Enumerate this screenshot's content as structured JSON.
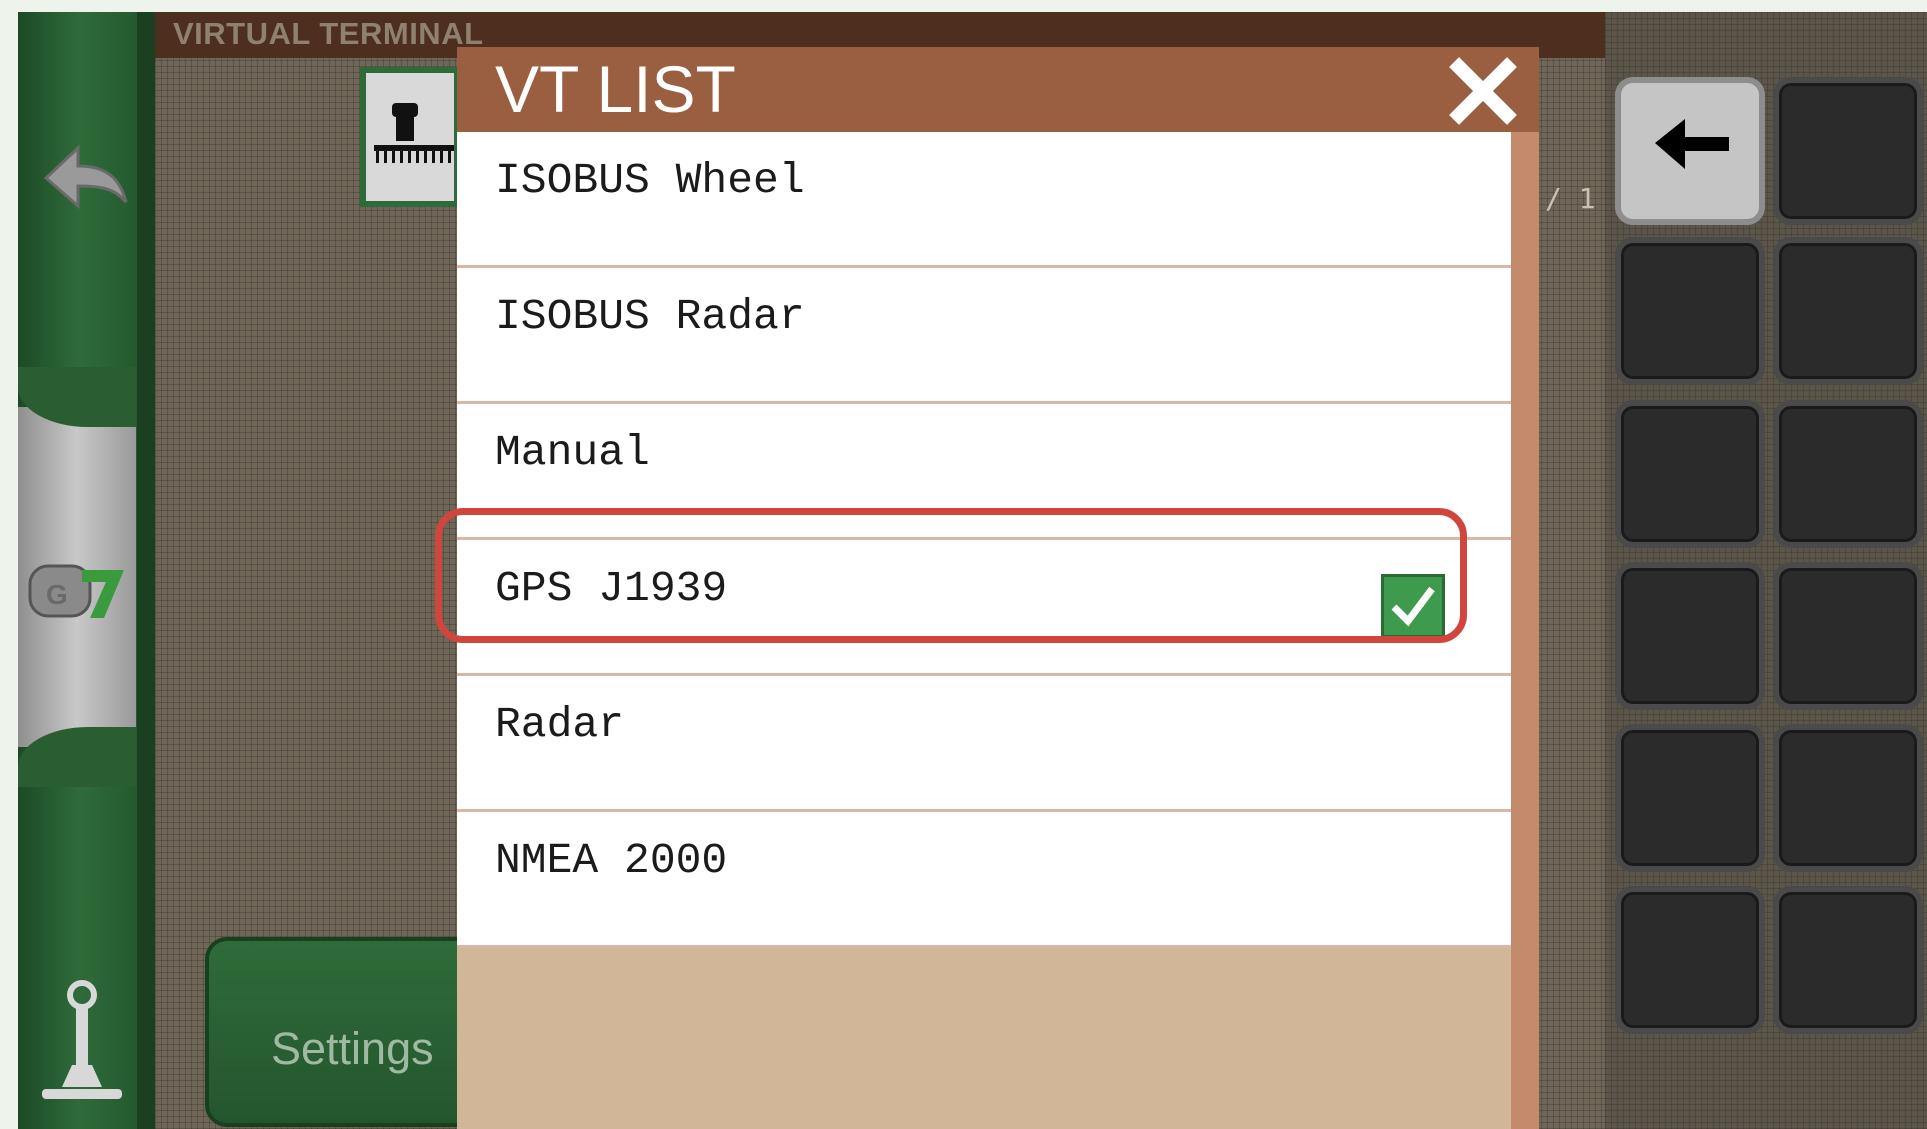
{
  "terminal": {
    "title": "VIRTUAL TERMINAL",
    "page_indicator": "/ 1",
    "settings_label": "Settings"
  },
  "modal": {
    "title": "VT LIST",
    "items": [
      {
        "label": "ISOBUS Wheel",
        "checked": false
      },
      {
        "label": "ISOBUS Radar",
        "checked": false
      },
      {
        "label": "Manual",
        "checked": false
      },
      {
        "label": "GPS J1939",
        "checked": true
      },
      {
        "label": "Radar",
        "checked": false
      },
      {
        "label": "NMEA 2000",
        "checked": false
      }
    ]
  },
  "colors": {
    "modal_header": "#9a5e41",
    "highlight": "#d0463e",
    "check": "#3e9b4d",
    "sidebar_green": "#2f6b3a"
  }
}
